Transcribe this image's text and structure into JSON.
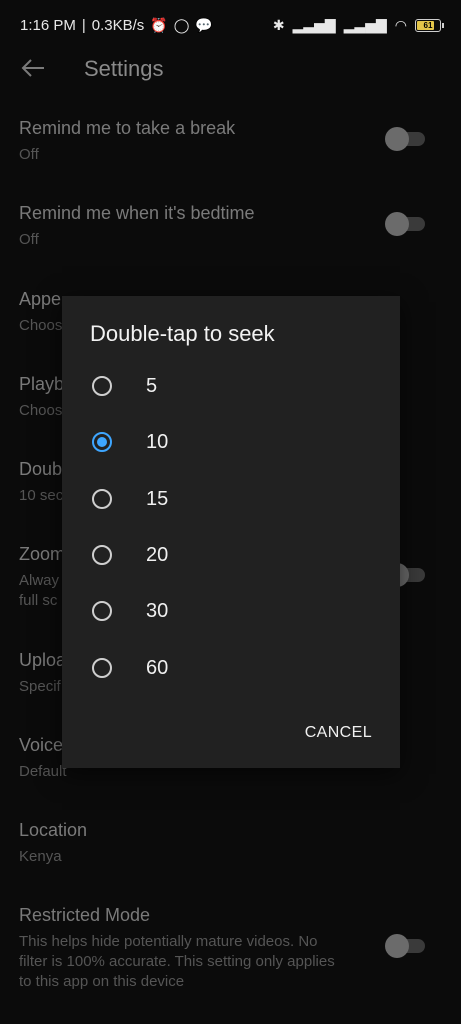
{
  "status_bar": {
    "time": "1:16 PM",
    "speed": "0.3KB/s",
    "battery": "61",
    "battery_color": "#e4c64a"
  },
  "app_bar": {
    "title": "Settings"
  },
  "settings": [
    {
      "title": "Remind me to take a break",
      "subtitle": "Off",
      "toggle": false
    },
    {
      "title": "Remind me when it's bedtime",
      "subtitle": "Off",
      "toggle": false
    },
    {
      "title": "Appe",
      "subtitle": "Choos"
    },
    {
      "title": "Playb",
      "subtitle": "Choos"
    },
    {
      "title": "Doub",
      "subtitle": "10 sec"
    },
    {
      "title": "Zoom",
      "subtitle": "Alway",
      "subtitle2": "full sc",
      "toggle": false
    },
    {
      "title": "Uploa",
      "subtitle": "Specif"
    },
    {
      "title": "Voice",
      "subtitle": "Default"
    },
    {
      "title": "Location",
      "subtitle": "Kenya"
    },
    {
      "title": "Restricted Mode",
      "subtitle": "This helps hide potentially mature videos. No filter is 100% accurate. This setting only applies to this app on this device",
      "toggle": false
    }
  ],
  "dialog": {
    "title": "Double-tap to seek",
    "options": [
      "5",
      "10",
      "15",
      "20",
      "30",
      "60"
    ],
    "selected": "10",
    "accent": "#3ea6ff",
    "cancel_label": "CANCEL"
  }
}
